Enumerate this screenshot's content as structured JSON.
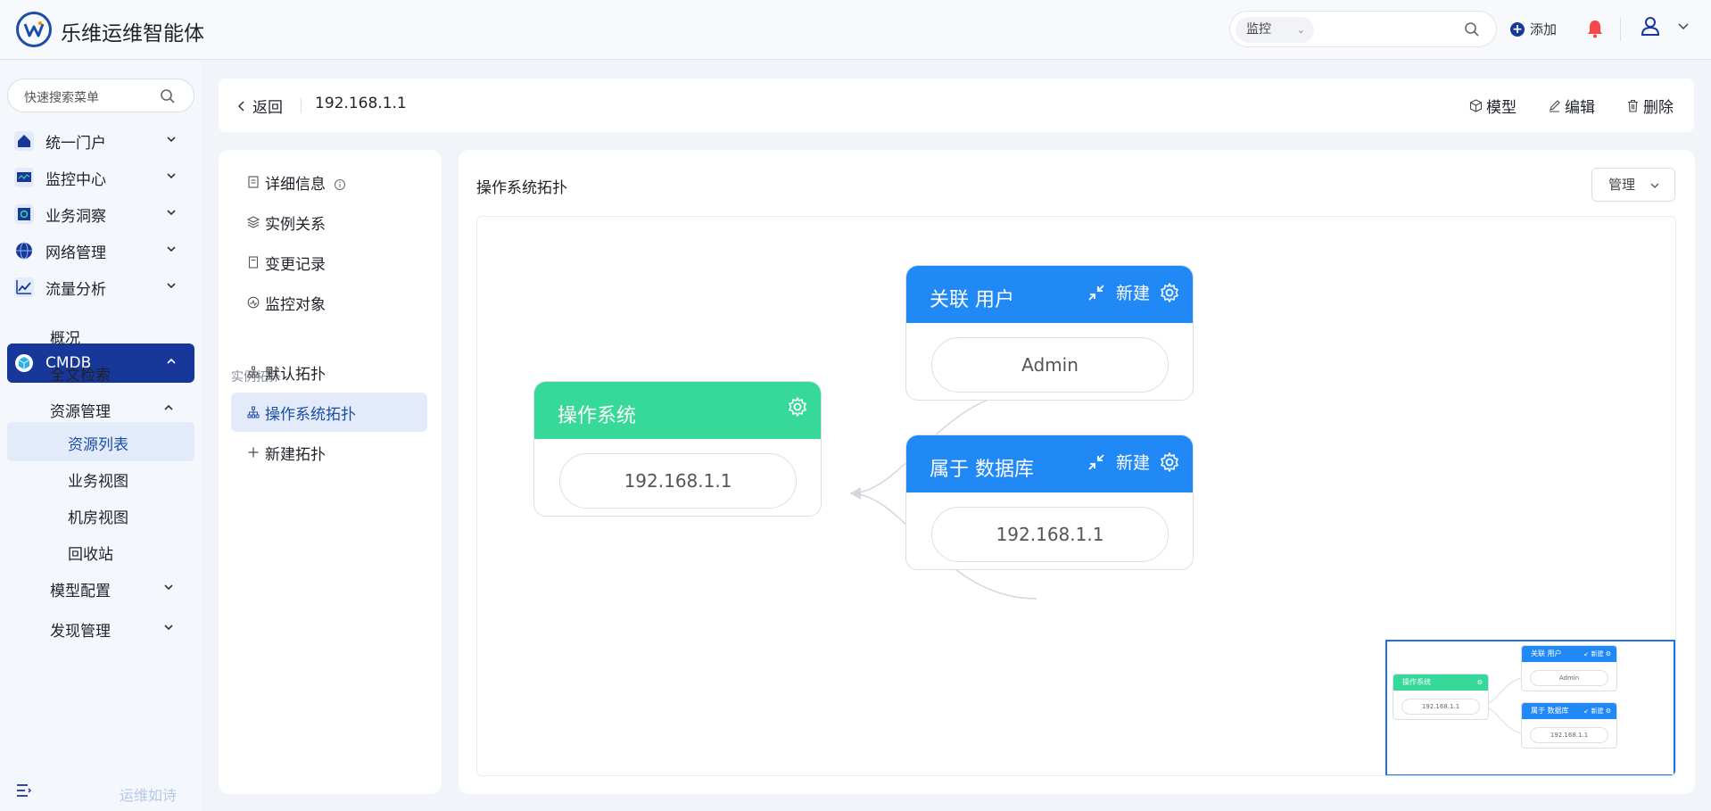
{
  "header": {
    "app_title": "乐维运维智能体",
    "search_category": "监控",
    "add_label": "添加"
  },
  "sidebar": {
    "search_placeholder": "快速搜索菜单",
    "items": [
      {
        "label": "统一门户",
        "icon": "portal-icon"
      },
      {
        "label": "监控中心",
        "icon": "monitor-icon"
      },
      {
        "label": "业务洞察",
        "icon": "insight-icon"
      },
      {
        "label": "网络管理",
        "icon": "network-icon"
      },
      {
        "label": "流量分析",
        "icon": "traffic-icon"
      },
      {
        "label": "CMDB",
        "icon": "cmdb-icon"
      }
    ],
    "cmdb_sub": {
      "overview": "概况",
      "fulltext": "全文检索",
      "resource_mgmt": "资源管理",
      "resource_list": "资源列表",
      "business_view": "业务视图",
      "room_view": "机房视图",
      "recycle": "回收站",
      "model_config": "模型配置",
      "discovery": "发现管理"
    },
    "slogan": "运维如诗"
  },
  "topbar": {
    "back_label": "返回",
    "breadcrumb": "192.168.1.1",
    "model_label": "模型",
    "edit_label": "编辑",
    "delete_label": "删除"
  },
  "left_panel": {
    "details": "详细信息",
    "instance_relation": "实例关系",
    "change_log": "变更记录",
    "monitor_object": "监控对象",
    "section_title": "实例拓扑",
    "default_topology": "默认拓扑",
    "os_topology": "操作系统拓扑",
    "new_topology": "新建拓扑"
  },
  "right_panel": {
    "title": "操作系统拓扑",
    "manage_label": "管理"
  },
  "topology": {
    "os_card": {
      "title": "操作系统",
      "node": "192.168.1.1",
      "color": "#36d99a"
    },
    "user_card": {
      "title": "关联 用户",
      "action": "新建",
      "node": "Admin",
      "color": "#2189f5"
    },
    "db_card": {
      "title": "属于 数据库",
      "action": "新建",
      "node": "192.168.1.1",
      "color": "#2189f5"
    }
  },
  "colors": {
    "primary": "#17389a",
    "accent_blue": "#2189f5",
    "accent_green": "#36d99a",
    "alert_red": "#f5484d",
    "selected_bg": "#e3ebfa"
  }
}
